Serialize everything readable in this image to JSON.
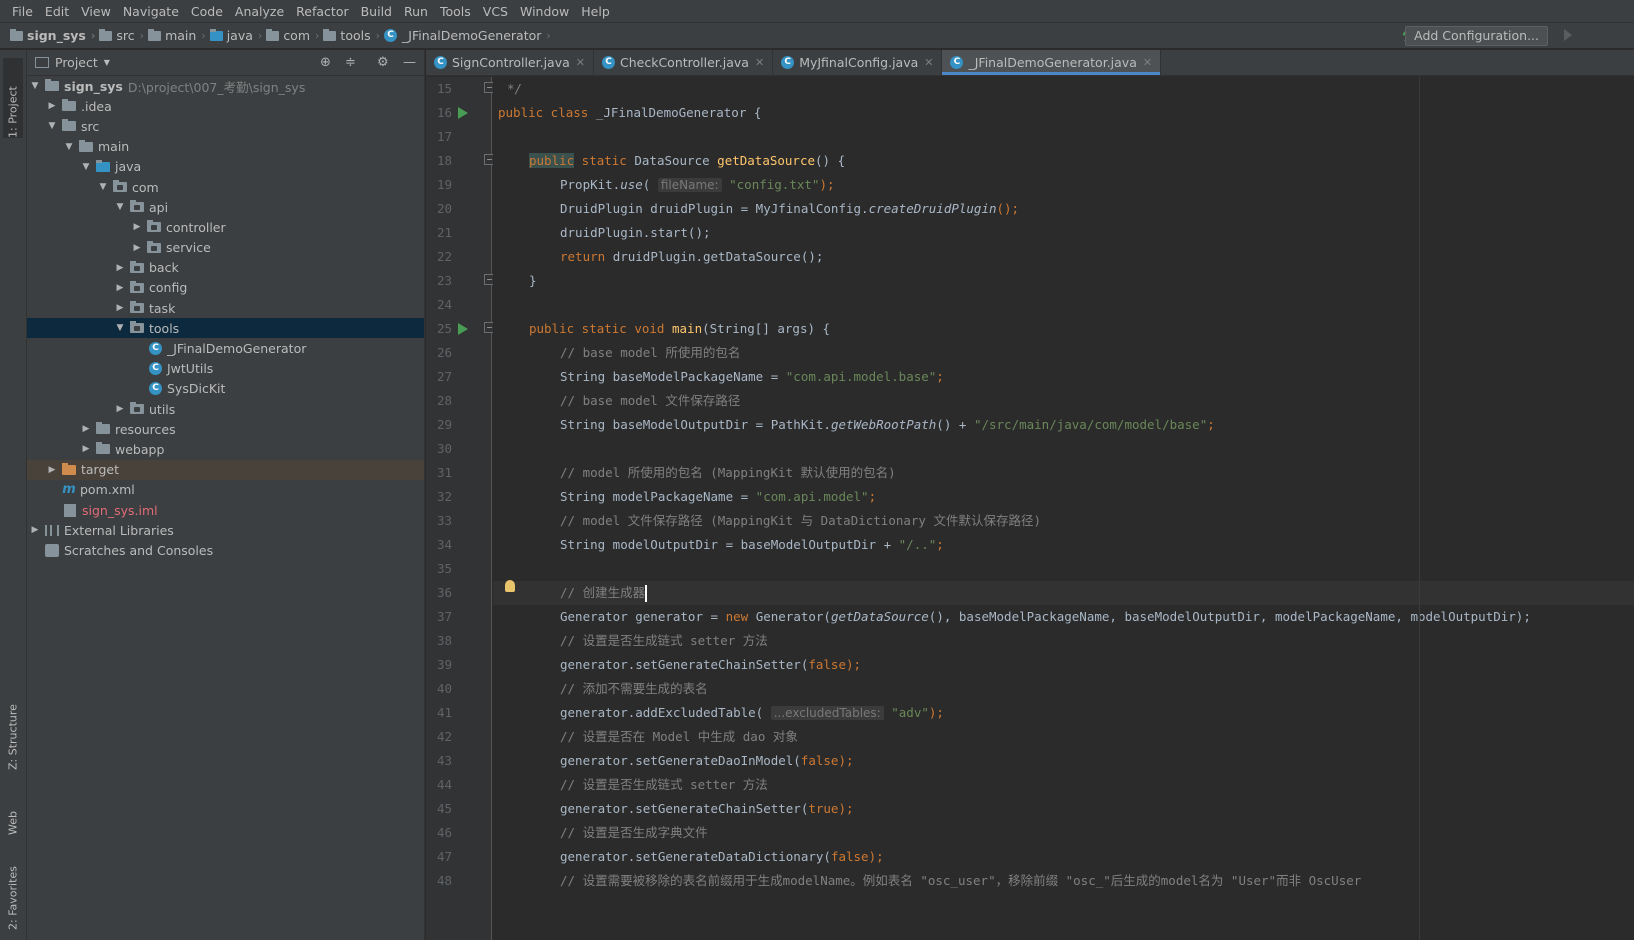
{
  "menu": [
    "File",
    "Edit",
    "View",
    "Navigate",
    "Code",
    "Analyze",
    "Refactor",
    "Build",
    "Run",
    "Tools",
    "VCS",
    "Window",
    "Help"
  ],
  "breadcrumbs": [
    "sign_sys",
    "src",
    "main",
    "java",
    "com",
    "tools",
    "_JFinalDemoGenerator"
  ],
  "add_configuration": "Add Configuration...",
  "side_tabs": {
    "project": "1: Project",
    "structure": "Z: Structure",
    "web": "Web",
    "favorites": "2: Favorites"
  },
  "project_panel": {
    "title": "Project",
    "tree": [
      {
        "label": "sign_sys",
        "path": "D:\\project\\007_考勤\\sign_sys"
      },
      {
        "label": ".idea"
      },
      {
        "label": "src"
      },
      {
        "label": "main"
      },
      {
        "label": "java"
      },
      {
        "label": "com"
      },
      {
        "label": "api"
      },
      {
        "label": "controller"
      },
      {
        "label": "service"
      },
      {
        "label": "back"
      },
      {
        "label": "config"
      },
      {
        "label": "task"
      },
      {
        "label": "tools"
      },
      {
        "label": "_JFinalDemoGenerator"
      },
      {
        "label": "JwtUtils"
      },
      {
        "label": "SysDicKit"
      },
      {
        "label": "utils"
      },
      {
        "label": "resources"
      },
      {
        "label": "webapp"
      },
      {
        "label": "target"
      },
      {
        "label": "pom.xml"
      },
      {
        "label": "sign_sys.iml"
      },
      {
        "label": "External Libraries"
      },
      {
        "label": "Scratches and Consoles"
      }
    ]
  },
  "tabs": [
    "SignController.java",
    "CheckController.java",
    "MyJfinalConfig.java",
    "_JFinalDemoGenerator.java"
  ],
  "code": {
    "line_numbers": [
      "15",
      "16",
      "17",
      "18",
      "19",
      "20",
      "21",
      "22",
      "23",
      "24",
      "25",
      "26",
      "27",
      "28",
      "29",
      "30",
      "31",
      "32",
      "33",
      "34",
      "35",
      "36",
      "37",
      "38",
      "39",
      "40",
      "41",
      "42",
      "43",
      "44",
      "45",
      "46",
      "47",
      "48"
    ],
    "l15": "*/",
    "l16_kw": "public class ",
    "l16_name": "_JFinalDemoGenerator {",
    "l18_kw1": "public",
    "l18_kw2": " static ",
    "l18_type": "DataSource ",
    "l18_fn": "getDataSource",
    "l18_rest": "() {",
    "l19_a": "PropKit.",
    "l19_b": "use",
    "l19_c": "( ",
    "l19_hint": "fileName:",
    "l19_str": " \"config.txt\"",
    "l19_d": ");",
    "l20_a": "DruidPlugin druidPlugin = MyJfinalConfig.",
    "l20_b": "createDruidPlugin",
    "l20_c": "();",
    "l21": "druidPlugin.start();",
    "l22_kw": "return ",
    "l22_rest": "druidPlugin.getDataSource();",
    "l23": "}",
    "l25_kw": "public static void ",
    "l25_fn": "main",
    "l25_rest": "(String[] args) {",
    "l26": "// base model 所使用的包名",
    "l27_a": "String baseModelPackageName = ",
    "l27_str": "\"com.api.model.base\"",
    "l27_b": ";",
    "l28": "// base model 文件保存路径",
    "l29_a": "String baseModelOutputDir = PathKit.",
    "l29_b": "getWebRootPath",
    "l29_c": "() + ",
    "l29_str": "\"/src/main/java/com/model/base\"",
    "l29_d": ";",
    "l31": "// model 所使用的包名 (MappingKit 默认使用的包名)",
    "l32_a": "String modelPackageName = ",
    "l32_str": "\"com.api.model\"",
    "l32_b": ";",
    "l33": "// model 文件保存路径 (MappingKit 与 DataDictionary 文件默认保存路径)",
    "l34_a": "String modelOutputDir = baseModelOutputDir + ",
    "l34_str": "\"/..\"",
    "l34_b": ";",
    "l36": "// 创建生成器",
    "l37_a": "Generator generator = ",
    "l37_kw": "new ",
    "l37_b": "Generator(",
    "l37_c": "getDataSource",
    "l37_d": "(), baseModelPackageName, baseModelOutputDir, modelPackageName, modelOutputDir);",
    "l38": "// 设置是否生成链式 setter 方法",
    "l39_a": "generator.setGenerateChainSetter(",
    "l39_kw": "false",
    "l39_b": ");",
    "l40": "// 添加不需要生成的表名",
    "l41_a": "generator.addExcludedTable( ",
    "l41_hint": "...excludedTables:",
    "l41_str": " \"adv\"",
    "l41_b": ");",
    "l42": "// 设置是否在 Model 中生成 dao 对象",
    "l43_a": "generator.setGenerateDaoInModel(",
    "l43_kw": "false",
    "l43_b": ");",
    "l44": "// 设置是否生成链式 setter 方法",
    "l45_a": "generator.setGenerateChainSetter(",
    "l45_kw": "true",
    "l45_b": ");",
    "l46": "// 设置是否生成字典文件",
    "l47_a": "generator.setGenerateDataDictionary(",
    "l47_kw": "false",
    "l47_b": ");",
    "l48": "// 设置需要被移除的表名前缀用于生成modelName。例如表名 \"osc_user\"，移除前缀 \"osc_\"后生成的model名为 \"User\"而非 OscUser"
  },
  "colors": {
    "keyword": "#cc7832",
    "string": "#6a8759",
    "comment": "#808080",
    "function": "#ffc66d",
    "selection": "#0d293e",
    "accent": "#4a88c7"
  }
}
